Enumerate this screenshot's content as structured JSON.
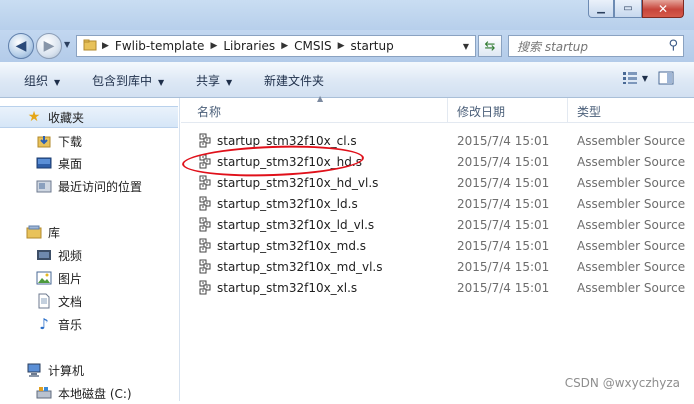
{
  "address": {
    "segments": [
      "Fwlib-template",
      "Libraries",
      "CMSIS",
      "startup"
    ]
  },
  "search": {
    "placeholder": "搜索 startup"
  },
  "toolbar": {
    "organize": "组织",
    "include_in_library": "包含到库中",
    "share": "共享",
    "new_folder": "新建文件夹"
  },
  "nav": {
    "favorites": "收藏夹",
    "downloads": "下载",
    "desktop": "桌面",
    "recent": "最近访问的位置",
    "libraries": "库",
    "videos": "视频",
    "pictures": "图片",
    "documents": "文档",
    "music": "音乐",
    "computer": "计算机",
    "local_disk": "本地磁盘 (C:)"
  },
  "columns": {
    "name": "名称",
    "modified": "修改日期",
    "type": "类型"
  },
  "files": [
    {
      "name": "startup_stm32f10x_cl.s",
      "date": "2015/7/4 15:01",
      "type": "Assembler Source"
    },
    {
      "name": "startup_stm32f10x_hd.s",
      "date": "2015/7/4 15:01",
      "type": "Assembler Source"
    },
    {
      "name": "startup_stm32f10x_hd_vl.s",
      "date": "2015/7/4 15:01",
      "type": "Assembler Source"
    },
    {
      "name": "startup_stm32f10x_ld.s",
      "date": "2015/7/4 15:01",
      "type": "Assembler Source"
    },
    {
      "name": "startup_stm32f10x_ld_vl.s",
      "date": "2015/7/4 15:01",
      "type": "Assembler Source"
    },
    {
      "name": "startup_stm32f10x_md.s",
      "date": "2015/7/4 15:01",
      "type": "Assembler Source"
    },
    {
      "name": "startup_stm32f10x_md_vl.s",
      "date": "2015/7/4 15:01",
      "type": "Assembler Source"
    },
    {
      "name": "startup_stm32f10x_xl.s",
      "date": "2015/7/4 15:01",
      "type": "Assembler Source"
    }
  ],
  "watermark": "CSDN @wxyczhyza",
  "colors": {
    "annotation_circle": "#e0101a",
    "titlebar": "#c9ddf2",
    "close_button": "#c7453b"
  }
}
